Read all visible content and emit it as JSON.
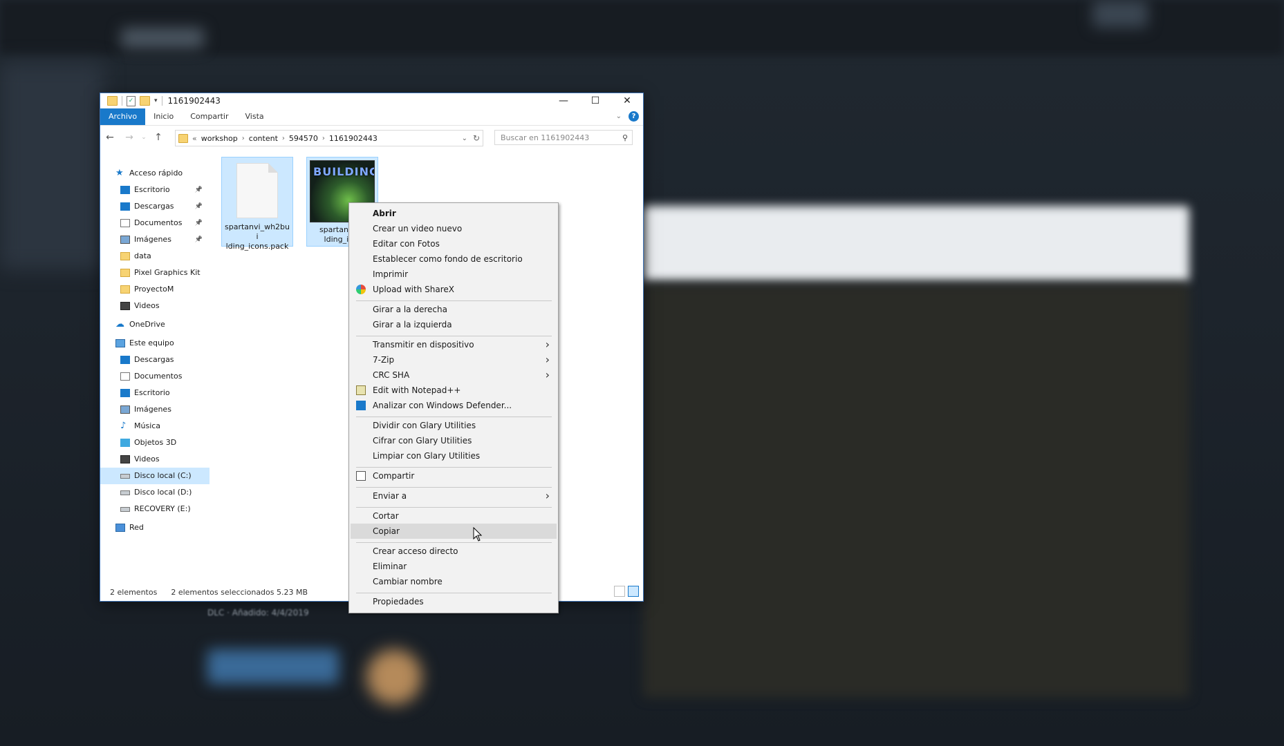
{
  "window": {
    "title": "1161902443",
    "controls": {
      "minimize": "—",
      "maximize": "☐",
      "close": "✕"
    }
  },
  "ribbon": {
    "tabs": [
      {
        "label": "Archivo",
        "active": true
      },
      {
        "label": "Inicio"
      },
      {
        "label": "Compartir"
      },
      {
        "label": "Vista"
      }
    ],
    "help": "?"
  },
  "address": {
    "prefix": "«",
    "crumbs": [
      "workshop",
      "content",
      "594570",
      "1161902443"
    ],
    "search_placeholder": "Buscar en 1161902443"
  },
  "sidebar": {
    "items": [
      {
        "label": "Acceso rápido",
        "icon": "star-icon",
        "level": 0
      },
      {
        "label": "Escritorio",
        "icon": "desktop-icon",
        "pinned": true,
        "level": 1
      },
      {
        "label": "Descargas",
        "icon": "download-icon",
        "pinned": true,
        "level": 1
      },
      {
        "label": "Documentos",
        "icon": "documents-icon",
        "pinned": true,
        "level": 1
      },
      {
        "label": "Imágenes",
        "icon": "images-icon",
        "pinned": true,
        "level": 1
      },
      {
        "label": "data",
        "icon": "folder-icon",
        "level": 1
      },
      {
        "label": "Pixel Graphics Kit",
        "icon": "folder-icon",
        "level": 1
      },
      {
        "label": "ProyectoM",
        "icon": "folder-icon",
        "level": 1
      },
      {
        "label": "Videos",
        "icon": "video-icon",
        "level": 1
      },
      {
        "label": "OneDrive",
        "icon": "cloud-icon",
        "level": 0
      },
      {
        "label": "Este equipo",
        "icon": "pc-icon",
        "level": 0
      },
      {
        "label": "Descargas",
        "icon": "download-icon",
        "level": 1
      },
      {
        "label": "Documentos",
        "icon": "documents-icon",
        "level": 1
      },
      {
        "label": "Escritorio",
        "icon": "desktop-icon",
        "level": 1
      },
      {
        "label": "Imágenes",
        "icon": "images-icon",
        "level": 1
      },
      {
        "label": "Música",
        "icon": "music-icon",
        "level": 1
      },
      {
        "label": "Objetos 3D",
        "icon": "cube-icon",
        "level": 1
      },
      {
        "label": "Videos",
        "icon": "video-icon",
        "level": 1
      },
      {
        "label": "Disco local (C:)",
        "icon": "drive-icon",
        "level": 1,
        "selected": true
      },
      {
        "label": "Disco local (D:)",
        "icon": "drive-icon",
        "level": 1
      },
      {
        "label": "RECOVERY (E:)",
        "icon": "drive-icon",
        "level": 1
      },
      {
        "label": "Red",
        "icon": "network-icon",
        "level": 0
      }
    ]
  },
  "files": [
    {
      "name": "spartanvi_wh2building_icons.pack",
      "line1": "spartanvi_wh2bui",
      "line2": "lding_icons.pack",
      "type": "document"
    },
    {
      "name": "spartanvi_wh2building_icons",
      "line1": "spartanvi_w",
      "line2": "lding_icor",
      "type": "image",
      "thumb_title": "BUILDING"
    }
  ],
  "status": {
    "count": "2 elementos",
    "selection": "2 elementos seleccionados  5.23 MB"
  },
  "context_menu": {
    "groups": [
      [
        {
          "label": "Abrir",
          "bold": true
        },
        {
          "label": "Crear un video nuevo"
        },
        {
          "label": "Editar con Fotos"
        },
        {
          "label": "Establecer como fondo de escritorio"
        },
        {
          "label": "Imprimir"
        },
        {
          "label": "Upload with ShareX",
          "icon": "sharex-icon"
        }
      ],
      [
        {
          "label": "Girar a la derecha"
        },
        {
          "label": "Girar a la izquierda"
        }
      ],
      [
        {
          "label": "Transmitir en dispositivo",
          "submenu": true
        },
        {
          "label": "7-Zip",
          "submenu": true
        },
        {
          "label": "CRC SHA",
          "submenu": true
        },
        {
          "label": "Edit with Notepad++",
          "icon": "notepad-icon"
        },
        {
          "label": "Analizar con Windows Defender...",
          "icon": "defender-icon"
        }
      ],
      [
        {
          "label": "Dividir con Glary Utilities"
        },
        {
          "label": "Cifrar con Glary Utilities"
        },
        {
          "label": "Limpiar con Glary Utilities"
        }
      ],
      [
        {
          "label": "Compartir",
          "icon": "share-icon"
        }
      ],
      [
        {
          "label": "Enviar a",
          "submenu": true
        }
      ],
      [
        {
          "label": "Cortar"
        },
        {
          "label": "Copiar",
          "hover": true
        }
      ],
      [
        {
          "label": "Crear acceso directo"
        },
        {
          "label": "Eliminar"
        },
        {
          "label": "Cambiar nombre"
        }
      ],
      [
        {
          "label": "Propiedades"
        }
      ]
    ]
  },
  "background_text": "DLC · Añadido: 4/4/2019"
}
